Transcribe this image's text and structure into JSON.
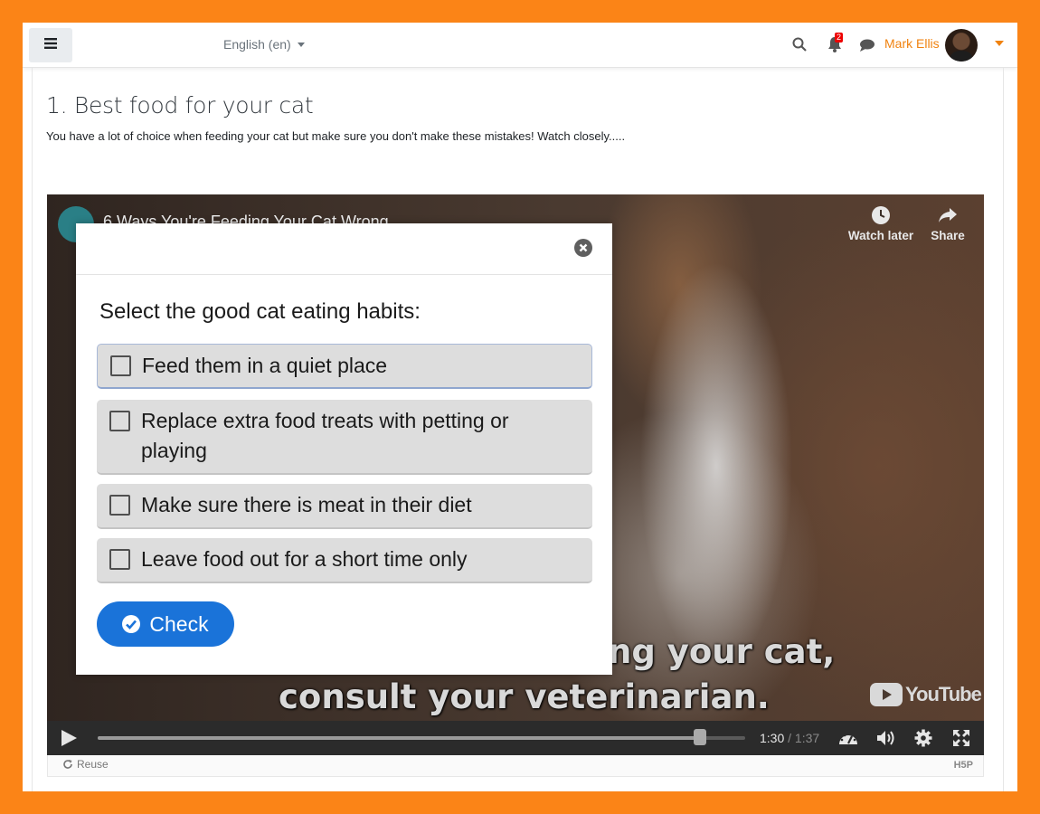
{
  "navbar": {
    "language": "English (en)",
    "notification_count": "2",
    "username": "Mark Ellis"
  },
  "page": {
    "title": "1. Best food for your cat",
    "description": "You have a lot of choice when feeding your cat but make sure you don't make these mistakes! Watch closely....."
  },
  "video": {
    "title": "6 Ways You're Feeding Your Cat Wrong",
    "watch_later_label": "Watch later",
    "share_label": "Share",
    "subtitle_line1": "ng your cat,",
    "subtitle_line2": "consult your veterinarian.",
    "youtube_logo": "YouTube",
    "progress": 0.93,
    "time_current": "1:30",
    "time_separator": " / ",
    "time_total": "1:37"
  },
  "footer": {
    "reuse_label": "Reuse",
    "h5p_logo": "H5P"
  },
  "quiz": {
    "question": "Select the good cat eating habits:",
    "answers": [
      {
        "label": "Feed them in a quiet place",
        "checked": false
      },
      {
        "label": "Replace extra food treats with petting or playing",
        "checked": false
      },
      {
        "label": "Make sure there is meat in their diet",
        "checked": false
      },
      {
        "label": "Leave food out for a short time only",
        "checked": false
      }
    ],
    "check_label": "Check"
  },
  "colors": {
    "background": "#fb8417",
    "accent": "#f0820f",
    "check_button": "#1a73d9"
  }
}
